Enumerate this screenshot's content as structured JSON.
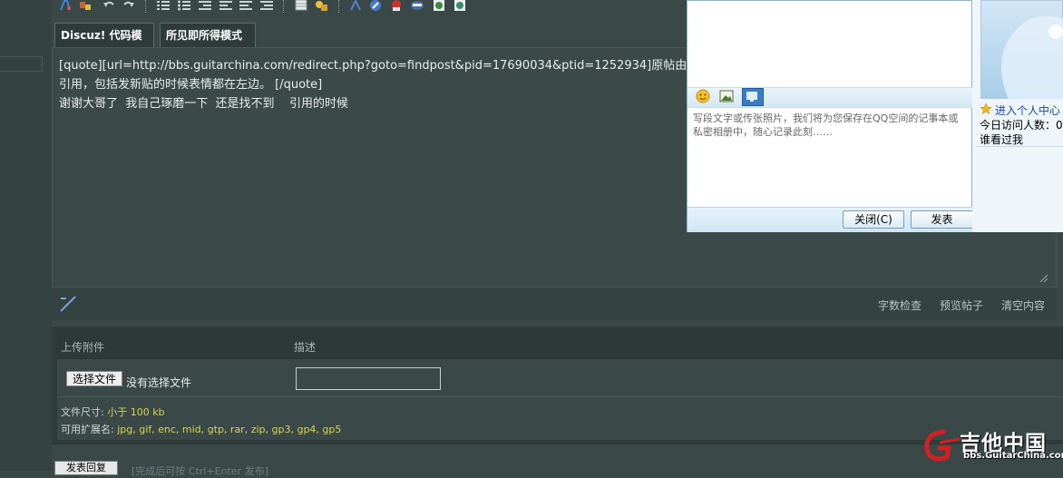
{
  "tabs": [
    {
      "label": "Discuz! 代码模式"
    },
    {
      "label": "所见即所得模式"
    }
  ],
  "editor": {
    "line1": "[quote][url=http://bbs.guitarchina.com/redirect.php?goto=findpost&pid=17690034&ptid=1252934]原帖由 [i]可乐",
    "line2": "引用，包括发新贴的时候表情都在左边。 [/quote]",
    "line3": "谢谢大哥了  我自己琢磨一下  还是找不到    引用的时候"
  },
  "editor_bar": {
    "word_check": "字数检查",
    "preview": "预览帖子",
    "clear": "清空内容"
  },
  "attachments": {
    "col_upload": "上传附件",
    "col_desc": "描述",
    "choose_button": "选择文件",
    "no_file": "没有选择文件",
    "size_label": "文件尺寸: ",
    "size_value": "小于 100 kb",
    "ext_label": "可用扩展名: ",
    "ext_value": "jpg, gif, enc, mid, gtp, rar, zip, gp3, gp4, gp5"
  },
  "submit": {
    "button_label": "发表回复",
    "hint": "[完成后可按 Ctrl+Enter 发布]"
  },
  "qq_popup": {
    "placeholder": "写段文字或传张照片，我们将为您保存在QQ空间的记事本或私密相册中，随心记录此刻……",
    "close_button": "关闭(C)",
    "post_button": "发表"
  },
  "qq_side": {
    "profile_link": "进入个人中心",
    "visits": "今日访问人数：0",
    "who_viewed": "谁看过我"
  },
  "logo": {
    "name": "吉他中国",
    "url": "bbs.GuitarChina.com"
  },
  "colors": {
    "page_bg": "#3a4848",
    "accent_yellow": "#d8d84a",
    "logo_red": "#d42020"
  },
  "icons": [
    "bold-icon",
    "color-icon",
    "undo-icon",
    "redo-icon",
    "ordered-list-icon",
    "unordered-list-icon",
    "outdent-icon",
    "indent-icon",
    "align-left-icon",
    "align-right-icon",
    "table-icon",
    "image-icon",
    "code-icon",
    "flash-icon",
    "media-icon",
    "quote-icon",
    "smiley-icon",
    "attach-icon"
  ]
}
